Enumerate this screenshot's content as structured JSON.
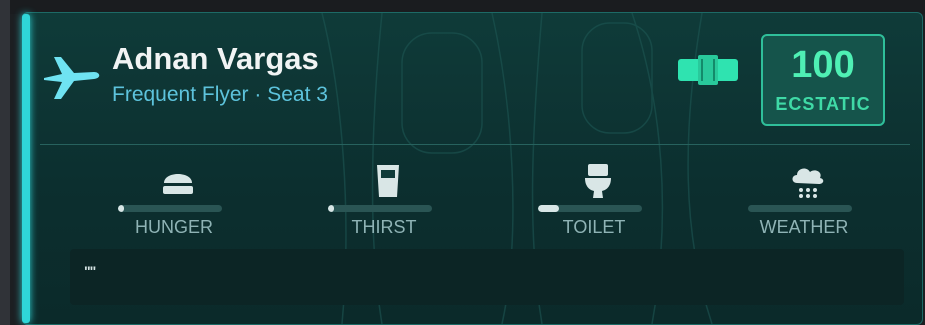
{
  "passenger": {
    "name": "Adnan Vargas",
    "subtitle": "Frequent Flyer · Seat 3"
  },
  "mood": {
    "value": "100",
    "label": "ECSTATIC"
  },
  "needs": [
    {
      "label": "HUNGER",
      "icon": "food-icon",
      "level": 0.05
    },
    {
      "label": "THIRST",
      "icon": "cup-icon",
      "level": 0.05
    },
    {
      "label": "TOILET",
      "icon": "toilet-icon",
      "level": 0.2
    },
    {
      "label": "WEATHER",
      "icon": "rain-cloud-icon",
      "level": 0
    }
  ],
  "message": {
    "text": "\"\""
  },
  "colors": {
    "accent": "#2fd6d8",
    "mood_text": "#4ff0b4",
    "subtitle": "#5dc3dc",
    "card_bg": "#0f3b39"
  }
}
